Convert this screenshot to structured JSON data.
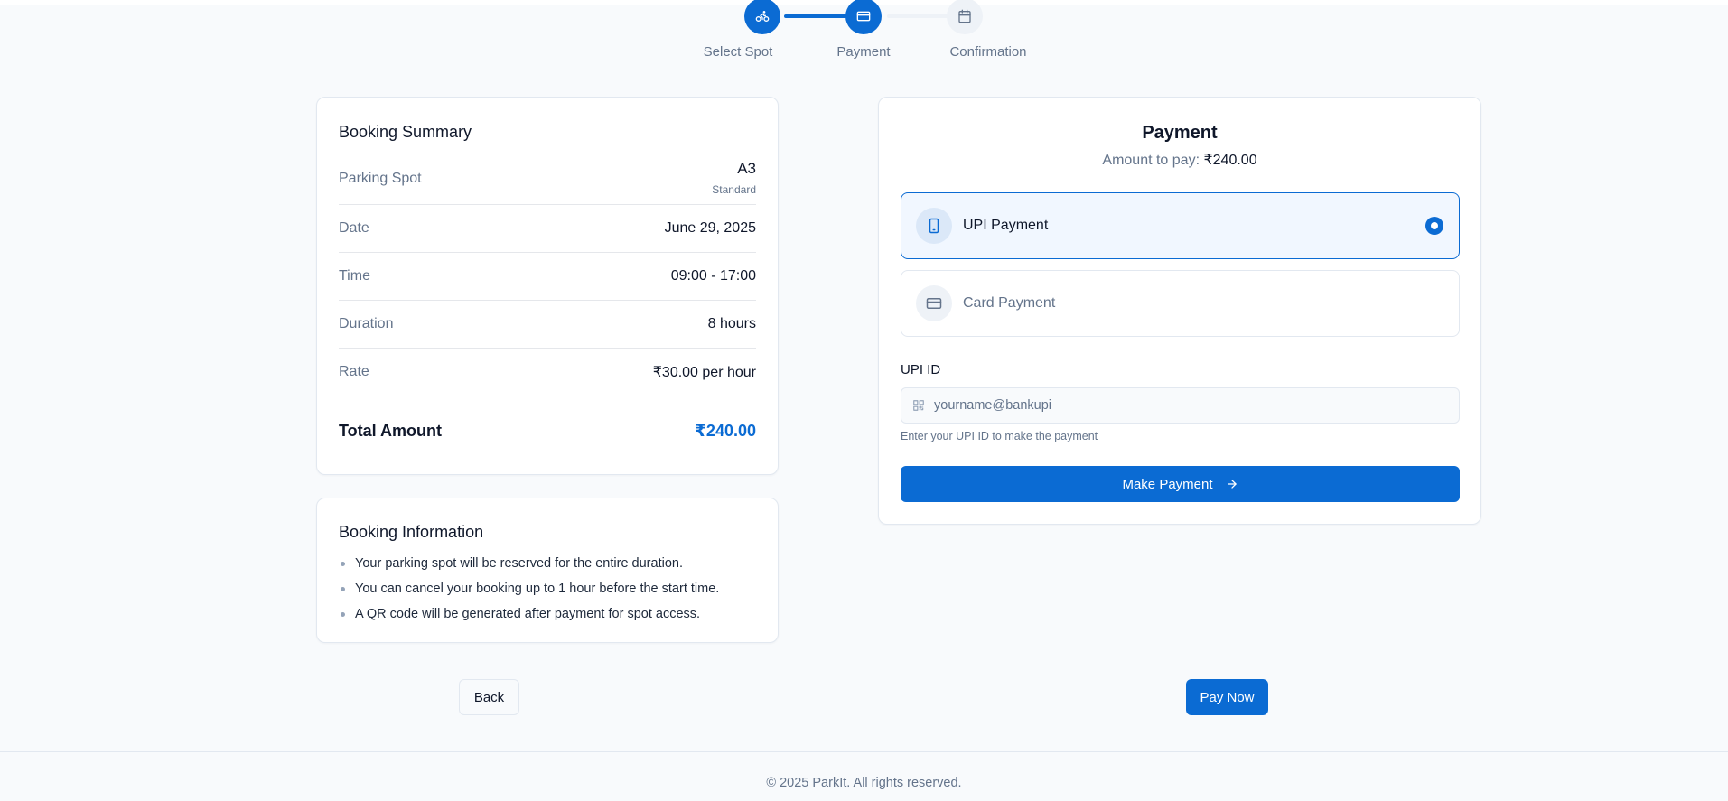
{
  "stepper": {
    "steps": [
      {
        "label": "Select Spot",
        "icon": "bike-icon",
        "state": "completed"
      },
      {
        "label": "Payment",
        "icon": "card-icon",
        "state": "active"
      },
      {
        "label": "Confirmation",
        "icon": "calendar-icon",
        "state": "pending"
      }
    ]
  },
  "summary": {
    "title": "Booking Summary",
    "spot_label": "Parking Spot",
    "spot_value": "A3",
    "spot_type": "Standard",
    "rows": [
      {
        "label": "Date",
        "value": "June 29, 2025"
      },
      {
        "label": "Time",
        "value": "09:00 - 17:00"
      },
      {
        "label": "Duration",
        "value": "8 hours"
      },
      {
        "label": "Rate",
        "value": "₹30.00 per hour"
      }
    ],
    "total_label": "Total Amount",
    "total_value": "₹240.00"
  },
  "info": {
    "title": "Booking Information",
    "items": [
      "Your parking spot will be reserved for the entire duration.",
      "You can cancel your booking up to 1 hour before the start time.",
      "A QR code will be generated after payment for spot access."
    ]
  },
  "payment": {
    "title": "Payment",
    "amount_prefix": "Amount to pay:",
    "amount": "₹240.00",
    "methods": [
      {
        "label": "UPI Payment",
        "icon": "phone-icon",
        "selected": true
      },
      {
        "label": "Card Payment",
        "icon": "card-icon",
        "selected": false
      }
    ],
    "upi_label": "UPI ID",
    "upi_placeholder": "yourname@bankupi",
    "upi_value": "",
    "helper": "Enter your UPI ID to make the payment",
    "make_payment_label": "Make Payment"
  },
  "actions": {
    "back_label": "Back",
    "pay_now_label": "Pay Now"
  },
  "footer": {
    "text": "© 2025 ParkIt. All rights reserved."
  },
  "colors": {
    "accent": "#0b6bd3",
    "background": "#f8fafc",
    "muted_text": "#64748b"
  }
}
